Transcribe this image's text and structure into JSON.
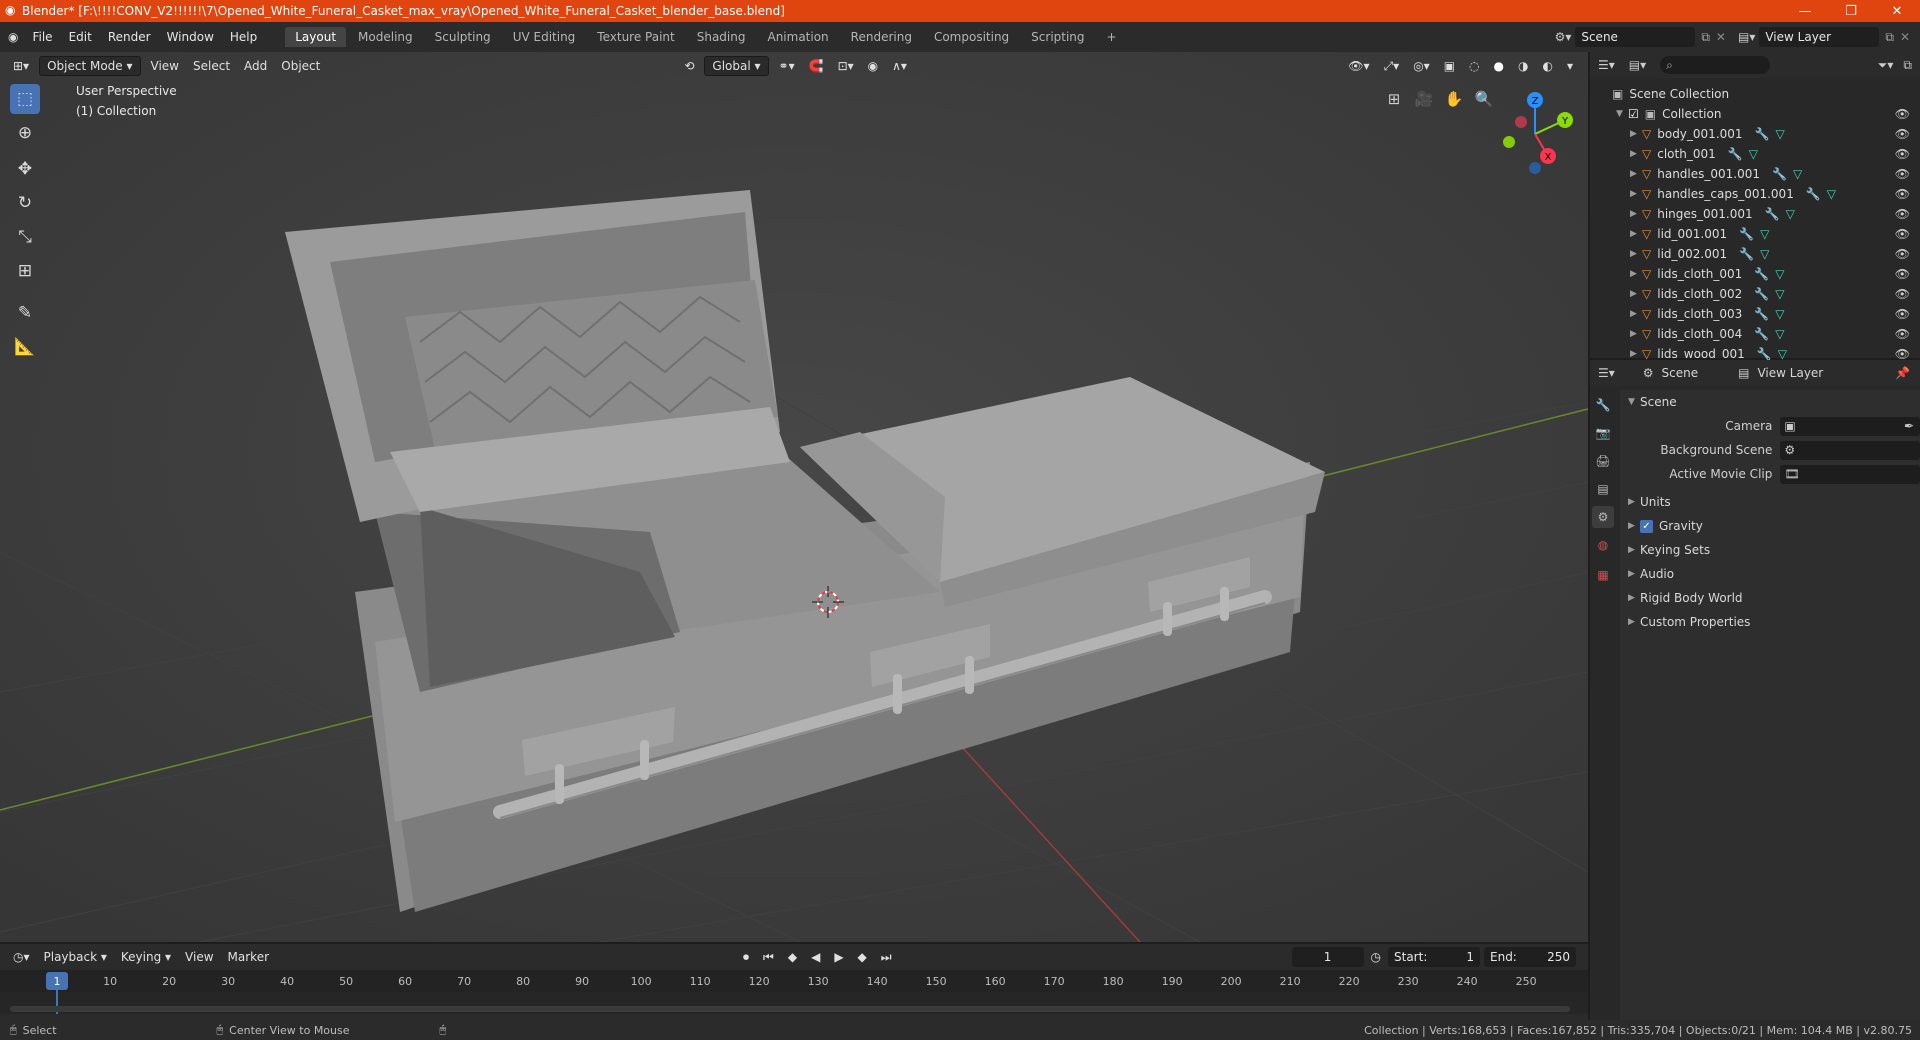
{
  "window": {
    "title": "Blender* [F:\\!!!!CONV_V2!!!!!!\\7\\Opened_White_Funeral_Casket_max_vray\\Opened_White_Funeral_Casket_blender_base.blend]",
    "minimize": "—",
    "restore": "❐",
    "close": "✕"
  },
  "menu": [
    "File",
    "Edit",
    "Render",
    "Window",
    "Help"
  ],
  "workspaces": [
    "Layout",
    "Modeling",
    "Sculpting",
    "UV Editing",
    "Texture Paint",
    "Shading",
    "Animation",
    "Rendering",
    "Compositing",
    "Scripting"
  ],
  "add_workspace": "+",
  "scene_field": "Scene",
  "view_layer_field": "View Layer",
  "viewport": {
    "mode": "Object Mode",
    "menus": [
      "View",
      "Select",
      "Add",
      "Object"
    ],
    "transform": "Global",
    "info_line1": "User Perspective",
    "info_line2": "(1) Collection",
    "gizmo": {
      "x": "X",
      "y": "Y",
      "z": "Z"
    }
  },
  "outliner": {
    "search_placeholder": "",
    "root": "Scene Collection",
    "collection": "Collection",
    "objects": [
      "body_001.001",
      "cloth_001",
      "handles_001.001",
      "handles_caps_001.001",
      "hinges_001.001",
      "lid_001.001",
      "lid_002.001",
      "lids_cloth_001",
      "lids_cloth_002",
      "lids_cloth_003",
      "lids_cloth_004",
      "lids_wood_001"
    ]
  },
  "properties": {
    "tab_scene": "Scene",
    "tab_view_layer": "View Layer",
    "section": "Scene",
    "fields": [
      {
        "label": "Camera",
        "value": ""
      },
      {
        "label": "Background Scene",
        "value": ""
      },
      {
        "label": "Active Movie Clip",
        "value": ""
      }
    ],
    "subsections": [
      "Units",
      "Gravity",
      "Keying Sets",
      "Audio",
      "Rigid Body World",
      "Custom Properties"
    ],
    "gravity_checked": true
  },
  "timeline": {
    "menus": [
      "Playback",
      "Keying",
      "View",
      "Marker"
    ],
    "current_frame": "1",
    "start_label": "Start:",
    "start": "1",
    "end_label": "End:",
    "end": "250",
    "ruler": [
      "1",
      "10",
      "20",
      "30",
      "40",
      "50",
      "60",
      "70",
      "80",
      "90",
      "100",
      "110",
      "120",
      "130",
      "140",
      "150",
      "160",
      "170",
      "180",
      "190",
      "200",
      "210",
      "220",
      "230",
      "240",
      "250"
    ]
  },
  "status": {
    "left1": "Select",
    "left2": "Center View to Mouse",
    "right": "Collection | Verts:168,653 | Faces:167,852 | Tris:335,704 | Objects:0/21 | Mem: 104.4 MB | v2.80.75"
  },
  "colors": {
    "title_bar": "#e1450f",
    "accent": "#4772b3",
    "x_axis": "#ff3352",
    "y_axis": "#8bdc00",
    "z_axis": "#2890ff"
  }
}
